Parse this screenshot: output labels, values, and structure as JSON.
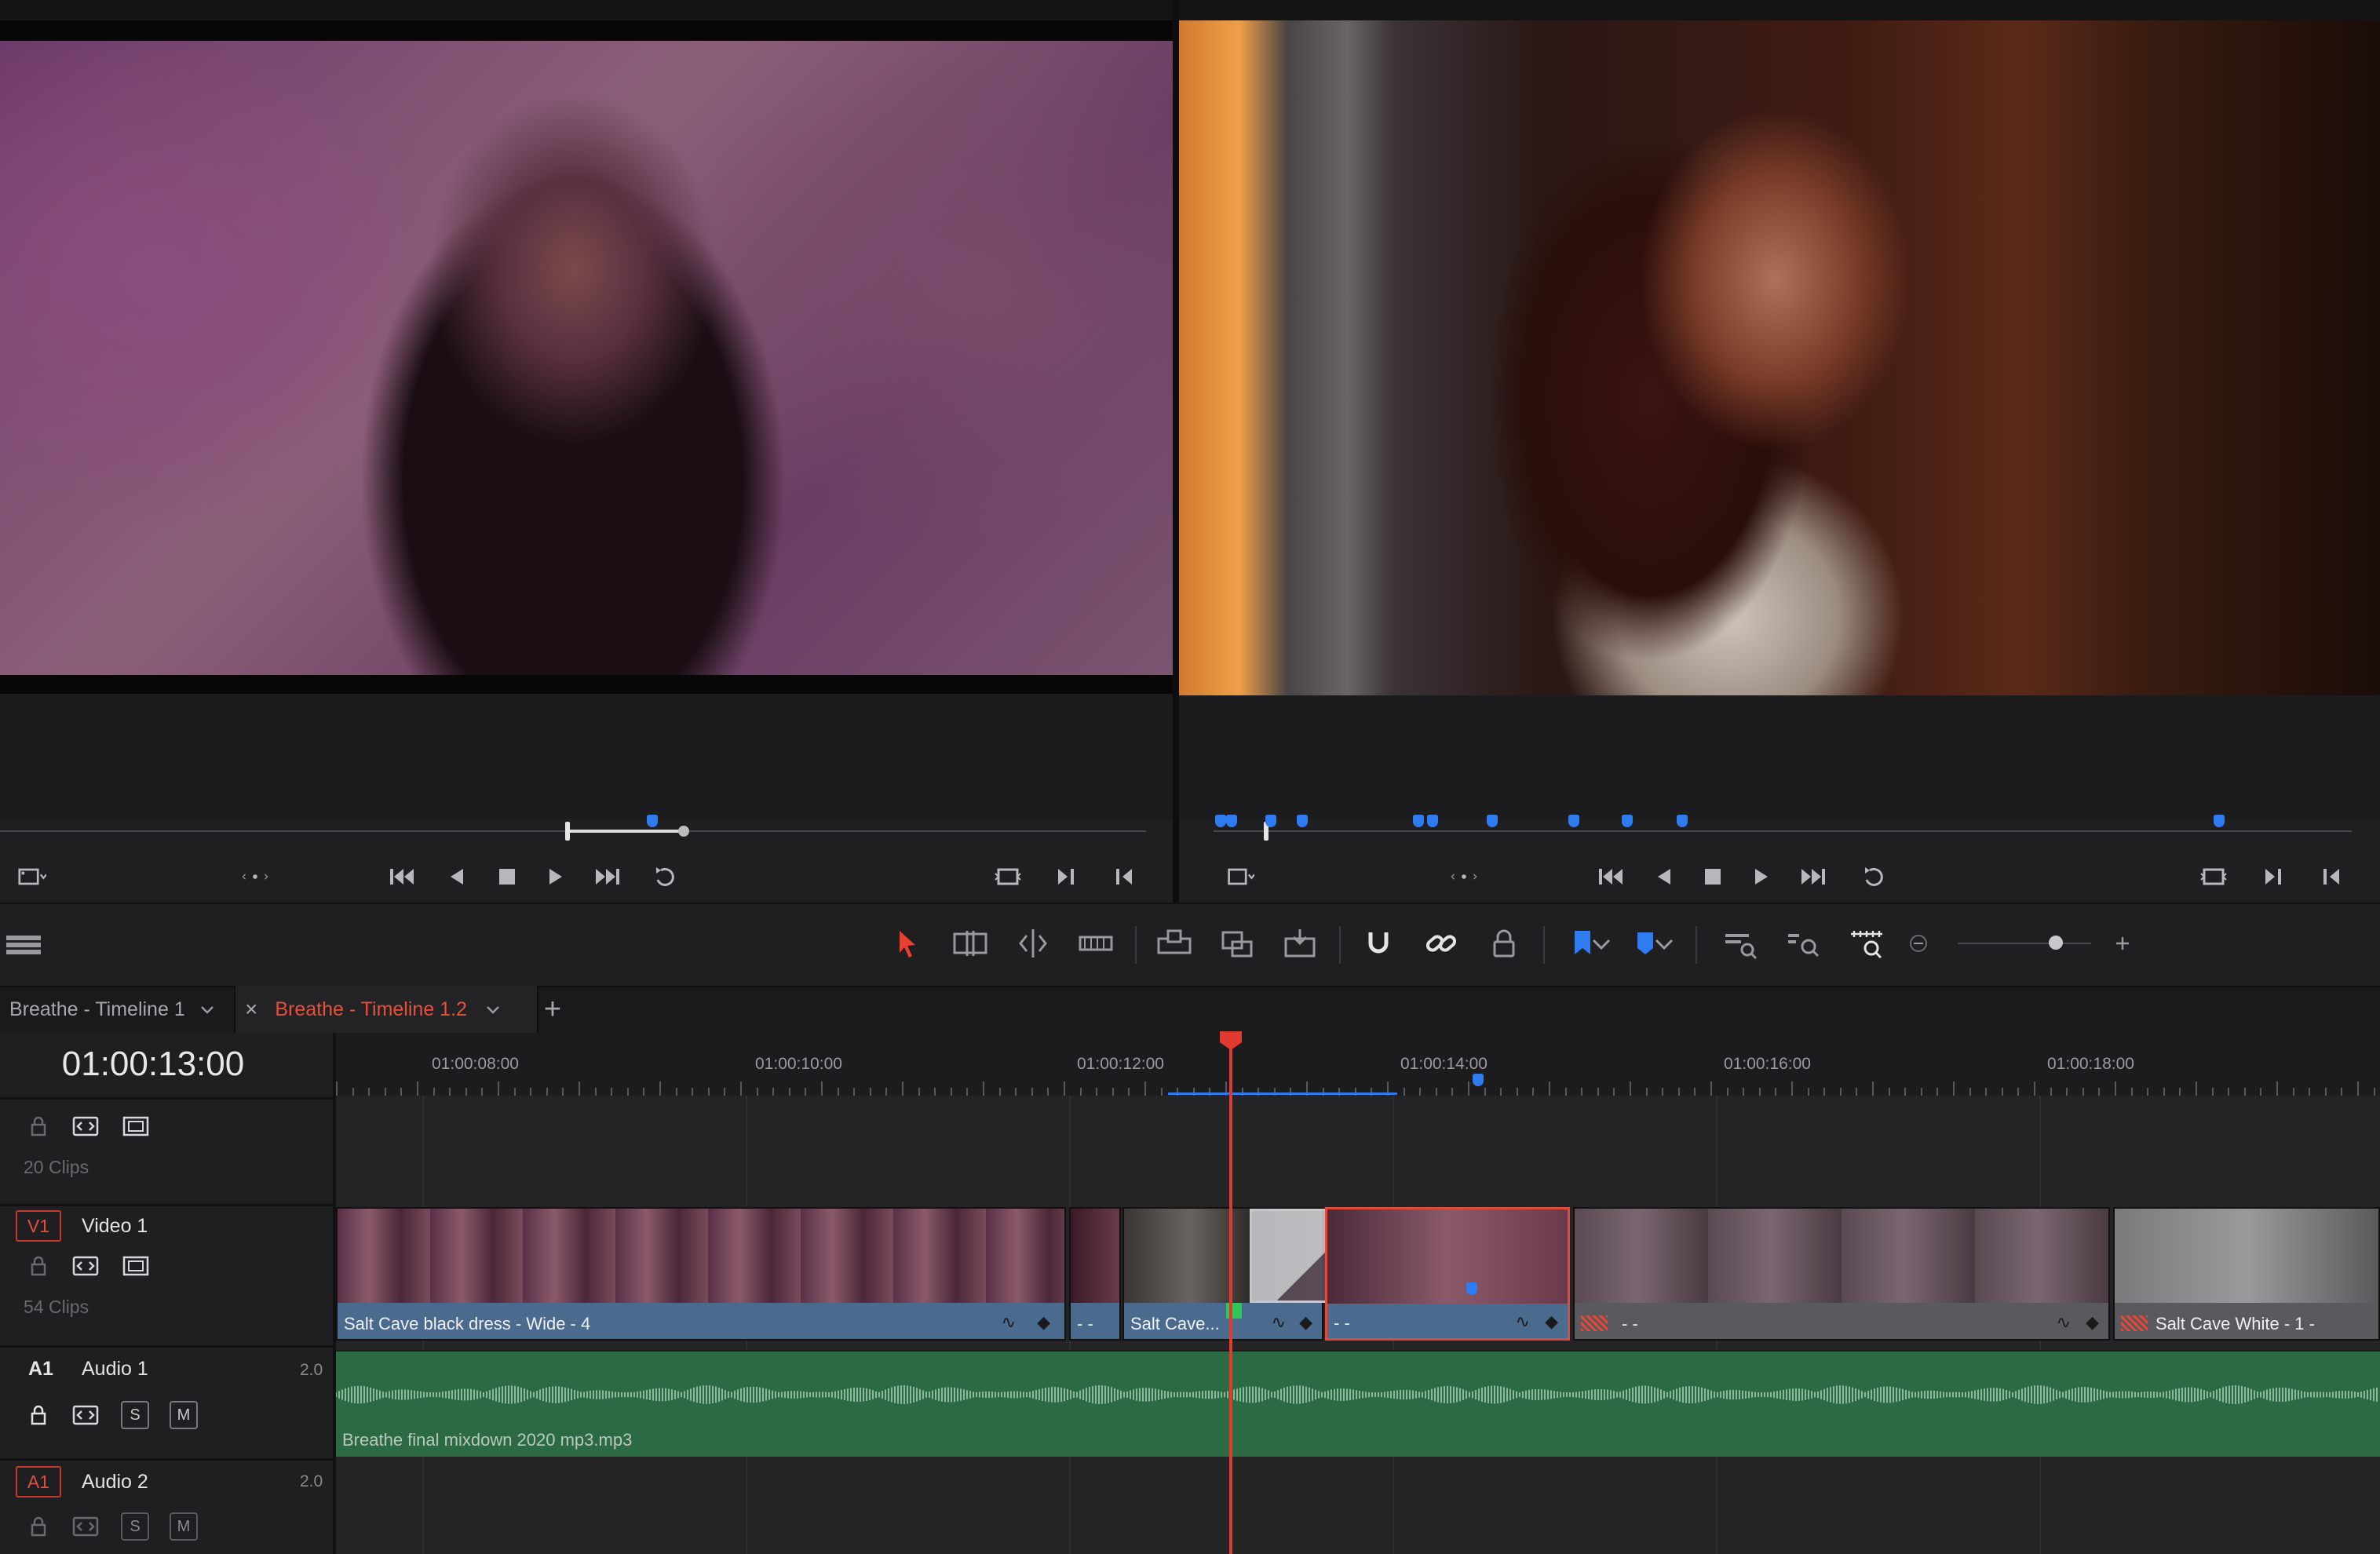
{
  "source_viewer": {
    "scrubber_markers": 1
  },
  "record_viewer": {
    "markers_count": 12
  },
  "timeline_tabs": [
    {
      "label": "Breathe - Timeline 1",
      "active": false
    },
    {
      "label": "Breathe - Timeline 1.2",
      "active": true
    }
  ],
  "add_tab_label": "+",
  "close_tab_label": "×",
  "timecode": "01:00:13:00",
  "ruler_labels": [
    "01:00:08:00",
    "01:00:10:00",
    "01:00:12:00",
    "01:00:14:00",
    "01:00:16:00",
    "01:00:18:00"
  ],
  "tracks": {
    "v2": {
      "clips_count": "20 Clips"
    },
    "v1": {
      "patch": "V1",
      "name": "Video 1",
      "clips_count": "54 Clips"
    },
    "a1": {
      "id": "A1",
      "name": "Audio 1",
      "channels": "2.0",
      "solo": "S",
      "mute": "M"
    },
    "a2": {
      "patch": "A1",
      "name": "Audio 2",
      "channels": "2.0",
      "solo": "S",
      "mute": "M"
    }
  },
  "clips": [
    {
      "label": "Salt Cave black dress - Wide - 4"
    },
    {
      "label": "- -"
    },
    {
      "label": "Salt Cave..."
    },
    {
      "label": "- -"
    },
    {
      "label": "- -"
    },
    {
      "label": "Salt Cave White - 1 -"
    }
  ],
  "audio_clip_label": "Breathe final mixdown 2020 mp3.mp3",
  "colors": {
    "accent_red": "#e03a2e",
    "marker_blue": "#2f7cf0",
    "video_clip": "#4a6a8e",
    "audio_clip": "#2c6a44"
  }
}
